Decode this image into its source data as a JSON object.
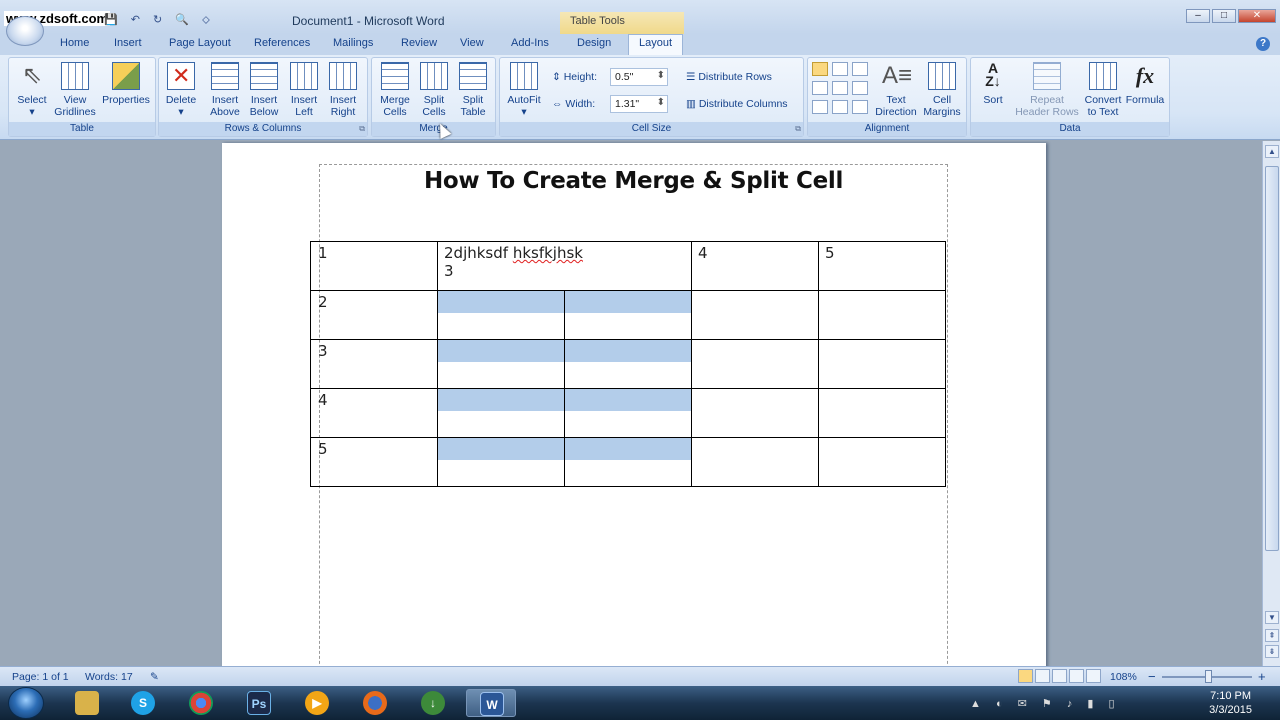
{
  "watermark": "www.zdsoft.com",
  "window": {
    "title": "Document1 - Microsoft Word",
    "context_tab": "Table Tools",
    "controls": [
      "–",
      "□",
      "✕"
    ]
  },
  "qat": {
    "save": "💾",
    "undo": "↶",
    "redo": "↻",
    "print": "🔍",
    "more": "⬦"
  },
  "tabs": [
    "Home",
    "Insert",
    "Page Layout",
    "References",
    "Mailings",
    "Review",
    "View",
    "Add-Ins",
    "Design",
    "Layout"
  ],
  "active_tab": "Layout",
  "help": "?",
  "ribbon": {
    "table": {
      "label": "Table",
      "select": "Select",
      "view_gridlines": [
        "View",
        "Gridlines"
      ],
      "properties": "Properties"
    },
    "rows_columns": {
      "label": "Rows & Columns",
      "delete": "Delete",
      "insert_above": [
        "Insert",
        "Above"
      ],
      "insert_below": [
        "Insert",
        "Below"
      ],
      "insert_left": [
        "Insert",
        "Left"
      ],
      "insert_right": [
        "Insert",
        "Right"
      ]
    },
    "merge": {
      "label": "Merge",
      "merge_cells": [
        "Merge",
        "Cells"
      ],
      "split_cells": [
        "Split",
        "Cells"
      ],
      "split_table": [
        "Split",
        "Table"
      ]
    },
    "cell_size": {
      "label": "Cell Size",
      "autofit": "AutoFit",
      "height_label": "Height:",
      "height_value": "0.5\"",
      "width_label": "Width:",
      "width_value": "1.31\"",
      "distribute_rows": "Distribute Rows",
      "distribute_columns": "Distribute Columns"
    },
    "alignment": {
      "label": "Alignment",
      "text_direction": [
        "Text",
        "Direction"
      ],
      "cell_margins": [
        "Cell",
        "Margins"
      ]
    },
    "data": {
      "label": "Data",
      "sort": "Sort",
      "repeat_header": [
        "Repeat",
        "Header Rows"
      ],
      "convert": [
        "Convert",
        "to Text"
      ],
      "formula": "Formula"
    }
  },
  "document": {
    "heading": "How To Create Merge & Split Cell",
    "rows": [
      [
        "1",
        "2djhksdf hksfkjhsk",
        "3",
        "4",
        "5"
      ],
      [
        "2",
        "",
        "",
        "",
        ""
      ],
      [
        "3",
        "",
        "",
        "",
        ""
      ],
      [
        "4",
        "",
        "",
        "",
        ""
      ],
      [
        "5",
        "",
        "",
        "",
        ""
      ]
    ]
  },
  "status": {
    "page": "Page: 1 of 1",
    "words": "Words: 17",
    "zoom": "108%",
    "zoom_minus": "−",
    "zoom_plus": "+"
  },
  "taskbar": {
    "time": "7:10 PM",
    "date": "3/3/2015",
    "apps": [
      "Explorer",
      "Skype",
      "Chrome",
      "Photoshop",
      "Media",
      "Firefox",
      "Manager",
      "Word"
    ]
  },
  "colors": {
    "ribbon_text": "#15428b",
    "highlight": "#b3cdea",
    "context_tab": "#f0d98a"
  }
}
